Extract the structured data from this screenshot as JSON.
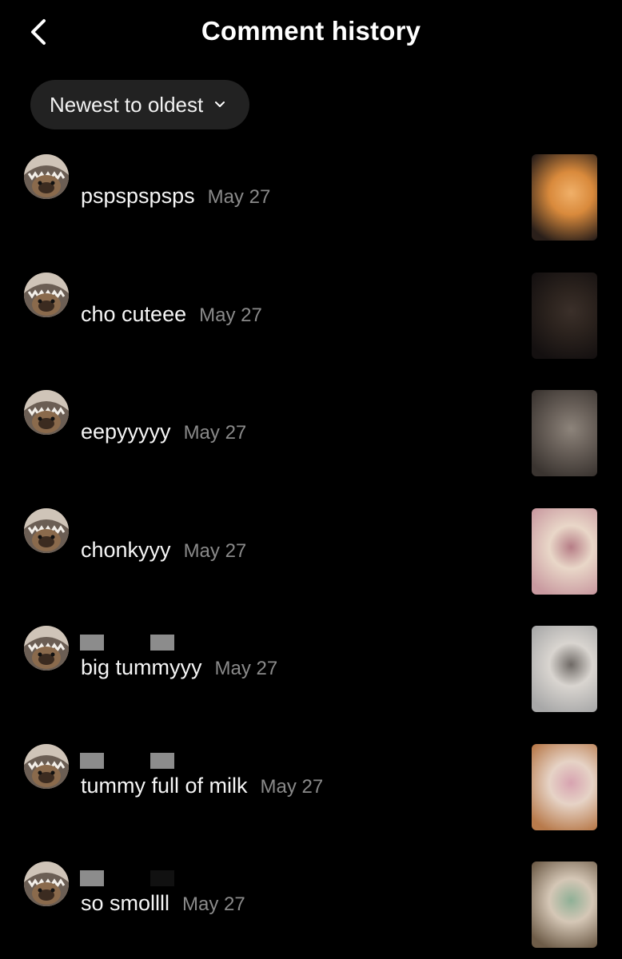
{
  "header": {
    "title": "Comment history",
    "back_icon": "chevron-left-icon"
  },
  "sort": {
    "label": "Newest to oldest",
    "icon": "chevron-down-icon"
  },
  "comments": [
    {
      "text": "pspspspsps",
      "date": "May 27",
      "thumb_colors": [
        "#2a1f1a",
        "#d98a3c",
        "#f0b069"
      ]
    },
    {
      "text": "cho cuteee",
      "date": "May 27",
      "thumb_colors": [
        "#141010",
        "#2c231e",
        "#3b302a"
      ]
    },
    {
      "text": "eepyyyyy",
      "date": "May 27",
      "thumb_colors": [
        "#3a3430",
        "#6b625b",
        "#8d847b"
      ]
    },
    {
      "text": "chonkyyy",
      "date": "May 27",
      "thumb_colors": [
        "#c99aa0",
        "#e9d7c8",
        "#b67d86"
      ]
    },
    {
      "text": "big tummyyy",
      "date": "May 27",
      "thumb_colors": [
        "#a8a8a8",
        "#d9d5d0",
        "#6f6a66"
      ]
    },
    {
      "text": "tummy full of milk",
      "date": "May 27",
      "thumb_colors": [
        "#b87a4b",
        "#e6d3c6",
        "#d7a3b0"
      ]
    },
    {
      "text": "so smollll",
      "date": "May 27",
      "thumb_colors": [
        "#6e5c48",
        "#d5c7b6",
        "#8fb096"
      ]
    }
  ]
}
